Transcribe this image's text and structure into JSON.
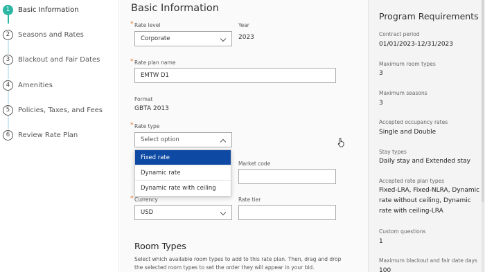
{
  "steps": [
    {
      "num": "1",
      "label": "Basic Information",
      "active": true
    },
    {
      "num": "2",
      "label": "Seasons and Rates"
    },
    {
      "num": "3",
      "label": "Blackout and Fair Dates"
    },
    {
      "num": "4",
      "label": "Amenities"
    },
    {
      "num": "5",
      "label": "Policies, Taxes, and Fees"
    },
    {
      "num": "6",
      "label": "Review Rate Plan"
    }
  ],
  "form": {
    "title": "Basic Information",
    "rate_level_label": "Rate level",
    "rate_level_value": "Corporate",
    "year_label": "Year",
    "year_value": "2023",
    "rate_plan_name_label": "Rate plan name",
    "rate_plan_name_value": "EMTW D1",
    "format_label": "Format",
    "format_value": "GBTA 2013",
    "rate_type_label": "Rate type",
    "rate_type_placeholder": "Select option",
    "rate_type_options": [
      "Fixed rate",
      "Dynamic rate",
      "Dynamic rate with ceiling"
    ],
    "market_code_label": "Market code",
    "currency_label": "Currency",
    "currency_value": "USD",
    "rate_tier_label": "Rate tier",
    "room_types_title": "Room Types",
    "room_types_desc": "Select which available room types to add to this rate plan. Then, drag and drop the selected room types to set the order they will appear in your bid."
  },
  "requirements": {
    "title": "Program Requirements",
    "items": [
      {
        "label": "Contract period",
        "value": "01/01/2023-12/31/2023"
      },
      {
        "label": "Maximum room types",
        "value": "3"
      },
      {
        "label": "Maximum seasons",
        "value": "3"
      },
      {
        "label": "Accepted occupancy rates",
        "value": "Single and Double"
      },
      {
        "label": "Stay types",
        "value": "Daily stay and Extended stay"
      },
      {
        "label": "Accepted rate plan types",
        "value": "Fixed-LRA, Fixed-NLRA, Dynamic rate without ceiling, Dynamic rate with ceiling-LRA"
      },
      {
        "label": "Custom questions",
        "value": "1"
      },
      {
        "label": "Maximum blackout and fair date days",
        "value": "100"
      }
    ]
  },
  "colors": {
    "accent": "#2cb6a3",
    "selected_option": "#0e4aa3",
    "required_marker": "#e06e1b"
  }
}
